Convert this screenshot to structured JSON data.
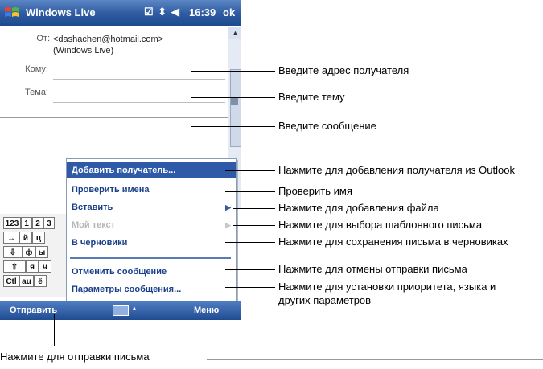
{
  "titlebar": {
    "app_title": "Windows Live",
    "time": "16:39",
    "ok_label": "ok",
    "icons": [
      "windows-start-icon",
      "message-status-icon",
      "connectivity-icon",
      "volume-icon"
    ]
  },
  "form": {
    "from_label": "От:",
    "from_value_line1": "<dashachen@hotmail.com>",
    "from_value_line2": "(Windows Live)",
    "to_label": "Кому:",
    "subject_label": "Тема:"
  },
  "keyboard": {
    "row1": [
      "123",
      "1",
      "2",
      "3"
    ],
    "row2": [
      "→",
      "й",
      "ц"
    ],
    "row3": [
      "⇩",
      "ф",
      "ы"
    ],
    "row4": [
      "⇧",
      "я",
      "ч"
    ],
    "row5": [
      "Ctl",
      "au",
      "ё"
    ]
  },
  "menu": {
    "items": [
      {
        "label": "Добавить получатель...",
        "state": "selected"
      },
      {
        "label": "Проверить имена",
        "state": "normal"
      },
      {
        "label": "Вставить",
        "state": "normal",
        "submenu": true
      },
      {
        "label": "Мой текст",
        "state": "disabled",
        "submenu": true
      },
      {
        "label": "В черновики",
        "state": "normal"
      },
      {
        "label": "Отменить сообщение",
        "state": "normal"
      },
      {
        "label": "Параметры сообщения...",
        "state": "normal"
      }
    ]
  },
  "menubar": {
    "left_softkey": "Отправить",
    "right_softkey": "Меню"
  },
  "callouts": {
    "recipient": "Введите адрес получателя",
    "subject": "Введите тему",
    "message": "Введите сообщение",
    "add_recipient": "Нажмите для добавления получателя из Outlook",
    "check_names": "Проверить имя",
    "insert_file": "Нажмите для добавления файла",
    "template": "Нажмите для выбора шаблонного письма",
    "drafts": "Нажмите для сохранения письма в черновиках",
    "cancel": "Нажмите для отмены отправки письма",
    "options_line1": "Нажмите для установки приоритета, языка и",
    "options_line2": "других параметров",
    "send": "Нажмите для отправки письма"
  },
  "colors": {
    "titlebar": "#2d5aa0",
    "menu_selected": "#2e5aa8",
    "menu_text": "#1a3f8a"
  }
}
